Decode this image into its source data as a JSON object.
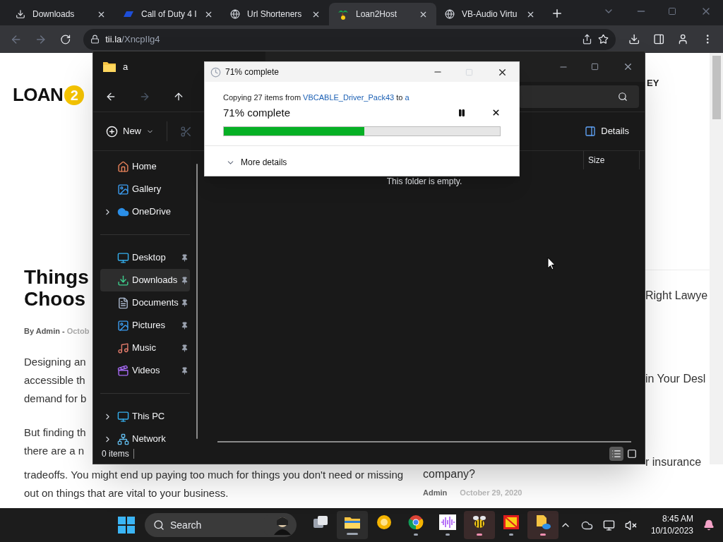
{
  "browser": {
    "tabs": [
      {
        "kind": "download",
        "title": "Downloads",
        "selected": false
      },
      {
        "kind": "game",
        "title": "Call of Duty 4 I",
        "selected": false
      },
      {
        "kind": "globe",
        "title": "Url Shorteners",
        "selected": false
      },
      {
        "kind": "palm",
        "title": "Loan2Host",
        "selected": true
      },
      {
        "kind": "globe",
        "title": "VB-Audio Virtu",
        "selected": false
      }
    ],
    "address": {
      "host": "tii.la",
      "path": "/XncpIlg4"
    }
  },
  "webpage": {
    "logo": {
      "text": "LOAN",
      "badge": "2"
    },
    "nav_fragment": "EY",
    "title_lines": [
      "Things",
      "Choos"
    ],
    "byline": "By Admin -",
    "byline_date": "Octob",
    "paragraphs": [
      [
        "Designing an",
        "accessible th",
        "demand for b"
      ],
      [
        "But finding th",
        "there are a n"
      ]
    ],
    "bottom_lines": [
      "tradeoffs. You might end up paying too much for things you don't need or missing",
      "out on things that are vital to your business."
    ],
    "side_posts": [
      "Right Lawye",
      "in Your Desl",
      "r insurance"
    ],
    "last_post": {
      "title": "company?",
      "author": "Admin",
      "date": "October 29, 2020"
    }
  },
  "explorer": {
    "title": "a",
    "new_label": "New",
    "details_label": "Details",
    "column": "Size",
    "empty": "This folder is empty.",
    "status": "0 items",
    "nav": [
      [
        {
          "label": "Home",
          "kind": "home",
          "expandable": false,
          "pinned": false,
          "selected": false
        },
        {
          "label": "Gallery",
          "kind": "gallery",
          "expandable": false,
          "pinned": false,
          "selected": false
        },
        {
          "label": "OneDrive",
          "kind": "cloud",
          "expandable": true,
          "pinned": false,
          "selected": false
        }
      ],
      [
        {
          "label": "Desktop",
          "kind": "desktop",
          "expandable": false,
          "pinned": true,
          "selected": false
        },
        {
          "label": "Downloads",
          "kind": "download",
          "expandable": false,
          "pinned": true,
          "selected": true
        },
        {
          "label": "Documents",
          "kind": "document",
          "expandable": false,
          "pinned": true,
          "selected": false
        },
        {
          "label": "Pictures",
          "kind": "pictures",
          "expandable": false,
          "pinned": true,
          "selected": false
        },
        {
          "label": "Music",
          "kind": "music",
          "expandable": false,
          "pinned": true,
          "selected": false
        },
        {
          "label": "Videos",
          "kind": "video",
          "expandable": false,
          "pinned": true,
          "selected": false
        }
      ],
      [
        {
          "label": "This PC",
          "kind": "pc",
          "expandable": true,
          "pinned": false,
          "selected": false
        },
        {
          "label": "Network",
          "kind": "network",
          "expandable": true,
          "pinned": false,
          "selected": false
        }
      ]
    ],
    "views": [
      {
        "kind": "details",
        "selected": true
      },
      {
        "kind": "tiles",
        "selected": false
      }
    ]
  },
  "dialog": {
    "title": "71% complete",
    "prefix": "Copying 27 items from",
    "source": "VBCABLE_Driver_Pack43",
    "middle": "to",
    "destination": "a",
    "heading": "71% complete",
    "level": 0.51,
    "more": "More details"
  },
  "taskbar": {
    "search": "Search",
    "apps": [
      {
        "kind": "taskview",
        "running": false,
        "active": false,
        "attention": false
      },
      {
        "kind": "explorer",
        "running": true,
        "active": true,
        "attention": false
      },
      {
        "kind": "ring",
        "running": false,
        "active": false,
        "attention": false
      },
      {
        "kind": "chrome",
        "running": true,
        "active": false,
        "attention": false
      },
      {
        "kind": "audio",
        "running": true,
        "active": false,
        "attention": false
      },
      {
        "kind": "bee",
        "running": true,
        "active": false,
        "attention": true
      },
      {
        "kind": "slides",
        "running": true,
        "active": false,
        "attention": false
      },
      {
        "kind": "cloudfile",
        "running": true,
        "active": false,
        "attention": true
      }
    ],
    "time": "8:45 AM",
    "date": "10/10/2023"
  }
}
